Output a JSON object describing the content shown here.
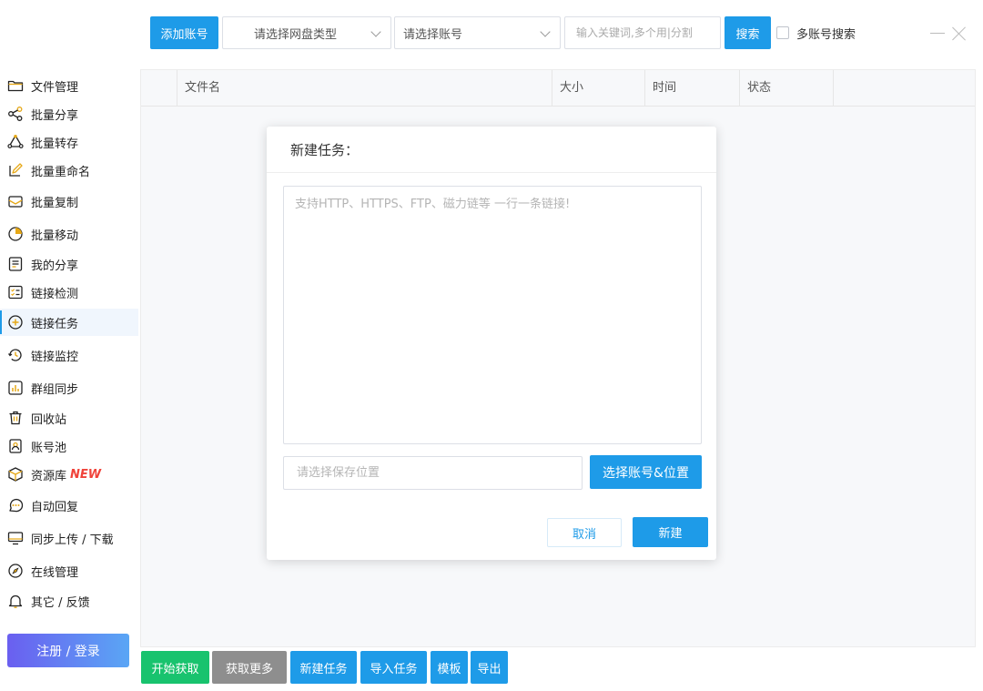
{
  "toolbar": {
    "add_account": "添加账号",
    "disk_type_select": "请选择网盘类型",
    "account_select": "请选择账号",
    "keyword_placeholder": "输入关键词,多个用|分割",
    "search_button": "搜索",
    "multi_account_label": "多账号搜索"
  },
  "sidebar": {
    "items": [
      {
        "label": "文件管理",
        "icon": "folder-icon"
      },
      {
        "label": "批量分享",
        "icon": "share-icon"
      },
      {
        "label": "批量转存",
        "icon": "transfer-icon"
      },
      {
        "label": "批量重命名",
        "icon": "rename-icon"
      },
      {
        "label": "批量复制",
        "icon": "copy-icon"
      },
      {
        "label": "批量移动",
        "icon": "move-icon"
      },
      {
        "label": "我的分享",
        "icon": "my-share-icon"
      },
      {
        "label": "链接检测",
        "icon": "checklist-icon"
      },
      {
        "label": "链接任务",
        "icon": "plus-circle-icon"
      },
      {
        "label": "链接监控",
        "icon": "history-icon"
      },
      {
        "label": "群组同步",
        "icon": "chart-icon"
      },
      {
        "label": "回收站",
        "icon": "trash-icon"
      },
      {
        "label": "账号池",
        "icon": "account-icon"
      },
      {
        "label": "资源库",
        "icon": "box-icon",
        "badge": "NEW"
      },
      {
        "label": "自动回复",
        "icon": "chat-icon"
      },
      {
        "label": "同步上传 / 下载",
        "icon": "monitor-icon"
      },
      {
        "label": "在线管理",
        "icon": "compass-icon"
      },
      {
        "label": "其它 / 反馈",
        "icon": "bell-icon"
      }
    ],
    "active_item": "链接任务",
    "login_button": "注册 / 登录"
  },
  "table": {
    "columns": [
      "文件名",
      "大小",
      "时间",
      "状态"
    ]
  },
  "bottom_bar": {
    "start_fetch": "开始获取",
    "fetch_more": "获取更多",
    "new_task": "新建任务",
    "import_task": "导入任务",
    "template": "模板",
    "export": "导出"
  },
  "modal": {
    "title": "新建任务：",
    "links_placeholder": "支持HTTP、HTTPS、FTP、磁力链等 一行一条链接!",
    "save_location_placeholder": "请选择保存位置",
    "choose_account_button": "选择账号&位置",
    "cancel_button": "取消",
    "create_button": "新建"
  },
  "colors": {
    "accent": "#1e9be8",
    "green": "#18c36e",
    "gray": "#8e8e8e",
    "new_badge": "#f0433a"
  }
}
